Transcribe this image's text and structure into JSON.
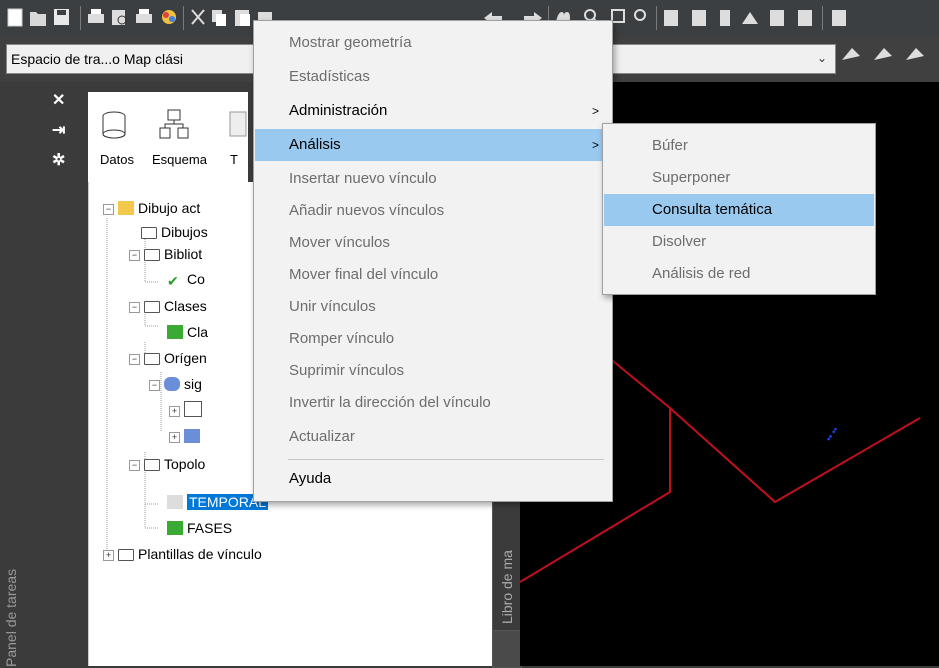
{
  "workspace": {
    "value": "Espacio de tra...o Map clási"
  },
  "palette": {
    "label": "Panel de tareas"
  },
  "task_pane": {
    "tabs": [
      "Datos",
      "Esquema",
      "T"
    ],
    "tree": {
      "root": "Dibujo act",
      "items": [
        "Dibujos",
        "Bibliot",
        "Co",
        "Clases",
        "Cla",
        "Orígen",
        "sig",
        "Topolo",
        "TEMPORAL",
        "FASES",
        "Plantillas de vínculo"
      ]
    }
  },
  "map_book_tab": "Libro de ma",
  "context_menu": {
    "items": [
      {
        "label": "Mostrar geometría",
        "enabled": false
      },
      {
        "label": "Estadísticas",
        "enabled": false
      },
      {
        "label": "Administración",
        "enabled": true,
        "submenu": true
      },
      {
        "label": "Análisis",
        "enabled": true,
        "submenu": true,
        "highlighted": true
      },
      {
        "label": "Insertar nuevo vínculo",
        "enabled": false
      },
      {
        "label": "Añadir nuevos vínculos",
        "enabled": false
      },
      {
        "label": "Mover vínculos",
        "enabled": false
      },
      {
        "label": "Mover final del vínculo",
        "enabled": false
      },
      {
        "label": "Unir vínculos",
        "enabled": false
      },
      {
        "label": "Romper vínculo",
        "enabled": false
      },
      {
        "label": "Suprimir vínculos",
        "enabled": false
      },
      {
        "label": "Invertir la dirección del vínculo",
        "enabled": false
      },
      {
        "label": "Actualizar",
        "enabled": false
      },
      {
        "label": "Ayuda",
        "enabled": true
      }
    ],
    "arrow": ">"
  },
  "submenu": {
    "items": [
      {
        "label": "Búfer",
        "enabled": false
      },
      {
        "label": "Superponer",
        "enabled": false
      },
      {
        "label": "Consulta temática",
        "enabled": true,
        "highlighted": true
      },
      {
        "label": "Disolver",
        "enabled": false
      },
      {
        "label": "Análisis de red",
        "enabled": false
      }
    ]
  },
  "colors": {
    "highlight": "#99c9ef",
    "selection": "#0078d7",
    "map_line": "#c0101e",
    "map_label": "#1a4fff"
  },
  "icons": [
    "new-icon",
    "open-icon",
    "save-icon",
    "print-icon",
    "preview-icon",
    "publish-icon",
    "render-icon",
    "cut-icon",
    "copy-icon",
    "paste-icon",
    "match-icon",
    "undo-icon",
    "redo-icon",
    "pan-icon",
    "zoom-icon",
    "zoom-window-icon",
    "zoom-previous-icon",
    "properties-icon",
    "design-center-icon",
    "tool-palettes-icon",
    "markup-icon",
    "calculator-icon"
  ]
}
